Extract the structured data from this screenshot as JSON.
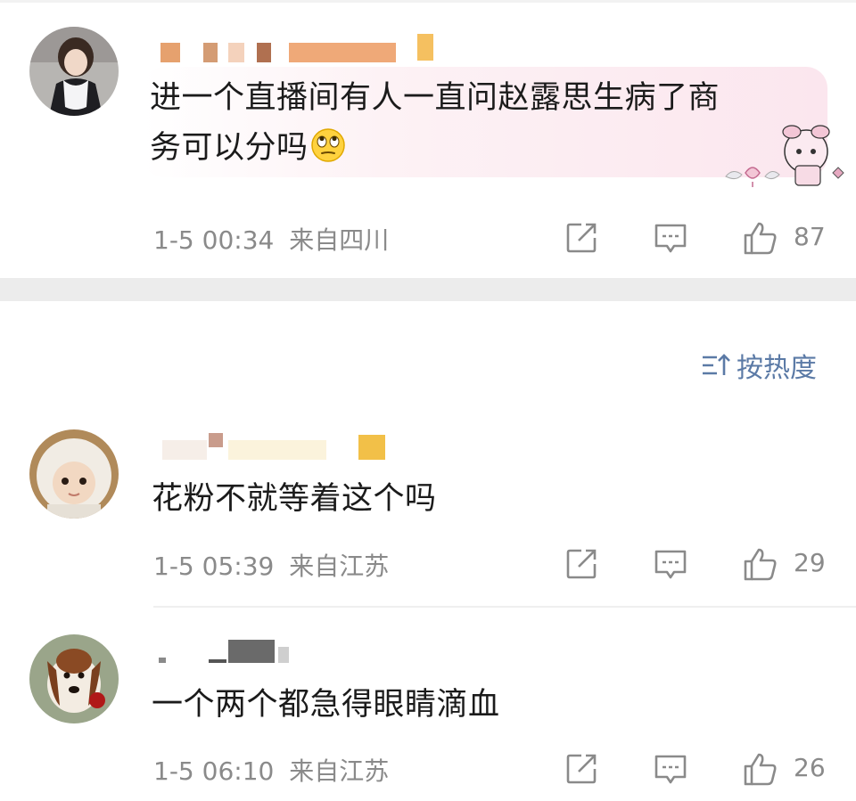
{
  "comments": [
    {
      "text_line1": "进一个直播间有人一直问赵露思生病了商",
      "text_line2": "务可以分吗",
      "emoji": "eye-roll-emoji",
      "time": "1-5 00:34",
      "location": "来自四川",
      "likes": "87",
      "has_sticker": true
    },
    {
      "text_line1": "花粉不就等着这个吗",
      "time": "1-5 05:39",
      "location": "来自江苏",
      "likes": "29"
    },
    {
      "text_line1": "一个两个都急得眼睛滴血",
      "time": "1-5 06:10",
      "location": "来自江苏",
      "likes": "26"
    }
  ],
  "sort": {
    "label": "按热度",
    "icon": "sort-icon"
  },
  "colors": {
    "accent": "#5b7aa6",
    "meta_gray": "#8a8a8a",
    "divider": "#ececec"
  },
  "icons": {
    "share": "share-icon",
    "comment": "comment-icon",
    "like": "thumbs-up-icon"
  }
}
